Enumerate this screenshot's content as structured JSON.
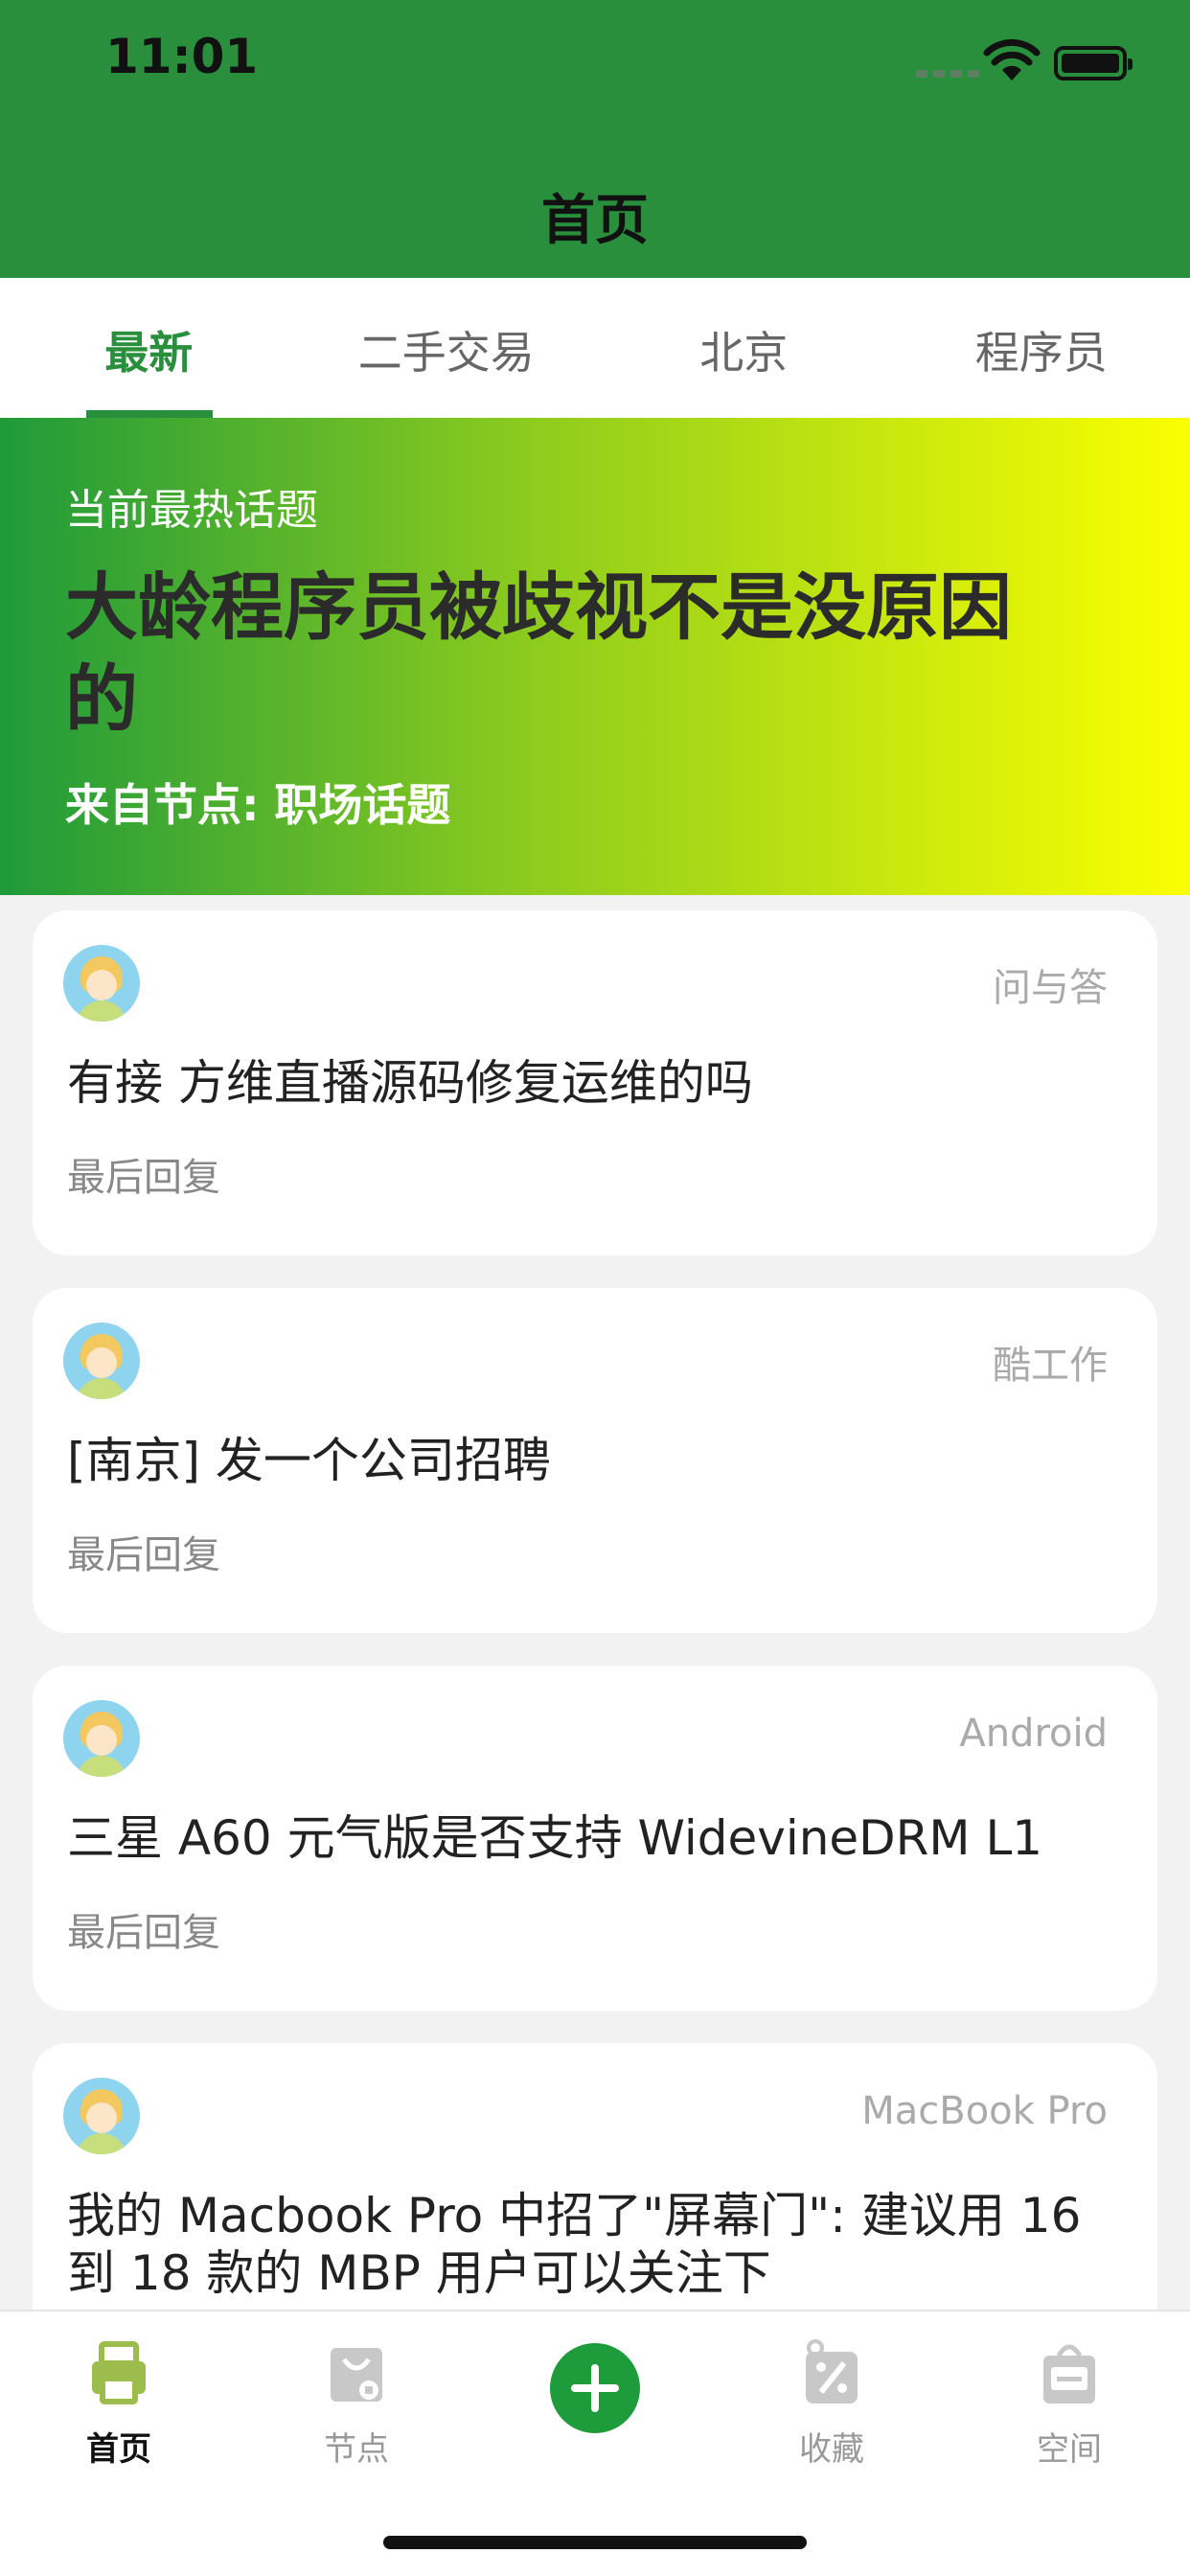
{
  "status_bar": {
    "time": "11:01"
  },
  "header": {
    "title": "首页"
  },
  "tabs": [
    {
      "label": "最新",
      "active": true
    },
    {
      "label": "二手交易",
      "active": false
    },
    {
      "label": "北京",
      "active": false
    },
    {
      "label": "程序员",
      "active": false
    }
  ],
  "hero": {
    "kicker": "当前最热话题",
    "title": "大龄程序员被歧视不是没原因的",
    "node": "来自节点: 职场话题"
  },
  "posts": [
    {
      "node": "问与答",
      "title": "有接 方维直播源码修复运维的吗",
      "meta": "最后回复"
    },
    {
      "node": "酷工作",
      "title": "[南京] 发一个公司招聘",
      "meta": "最后回复"
    },
    {
      "node": "Android",
      "title": "三星 A60 元气版是否支持 WidevineDRM L1",
      "meta": "最后回复"
    },
    {
      "node": "MacBook Pro",
      "title": "我的 Macbook Pro 中招了\"屏幕门\": 建议用 16 到 18 款的 MBP 用户可以关注下",
      "meta": ""
    }
  ],
  "bottom_nav": [
    {
      "label": "首页",
      "icon": "printer-icon",
      "active": true
    },
    {
      "label": "节点",
      "icon": "shopping-bag-icon",
      "active": false
    },
    {
      "label": "",
      "icon": "add-icon",
      "active": false
    },
    {
      "label": "收藏",
      "icon": "discount-tag-icon",
      "active": false
    },
    {
      "label": "空间",
      "icon": "sale-bag-icon",
      "active": false
    }
  ],
  "colors": {
    "brand_green": "#2a8f3d",
    "hero_start": "#1f9a3a",
    "hero_end": "#fbff00"
  }
}
